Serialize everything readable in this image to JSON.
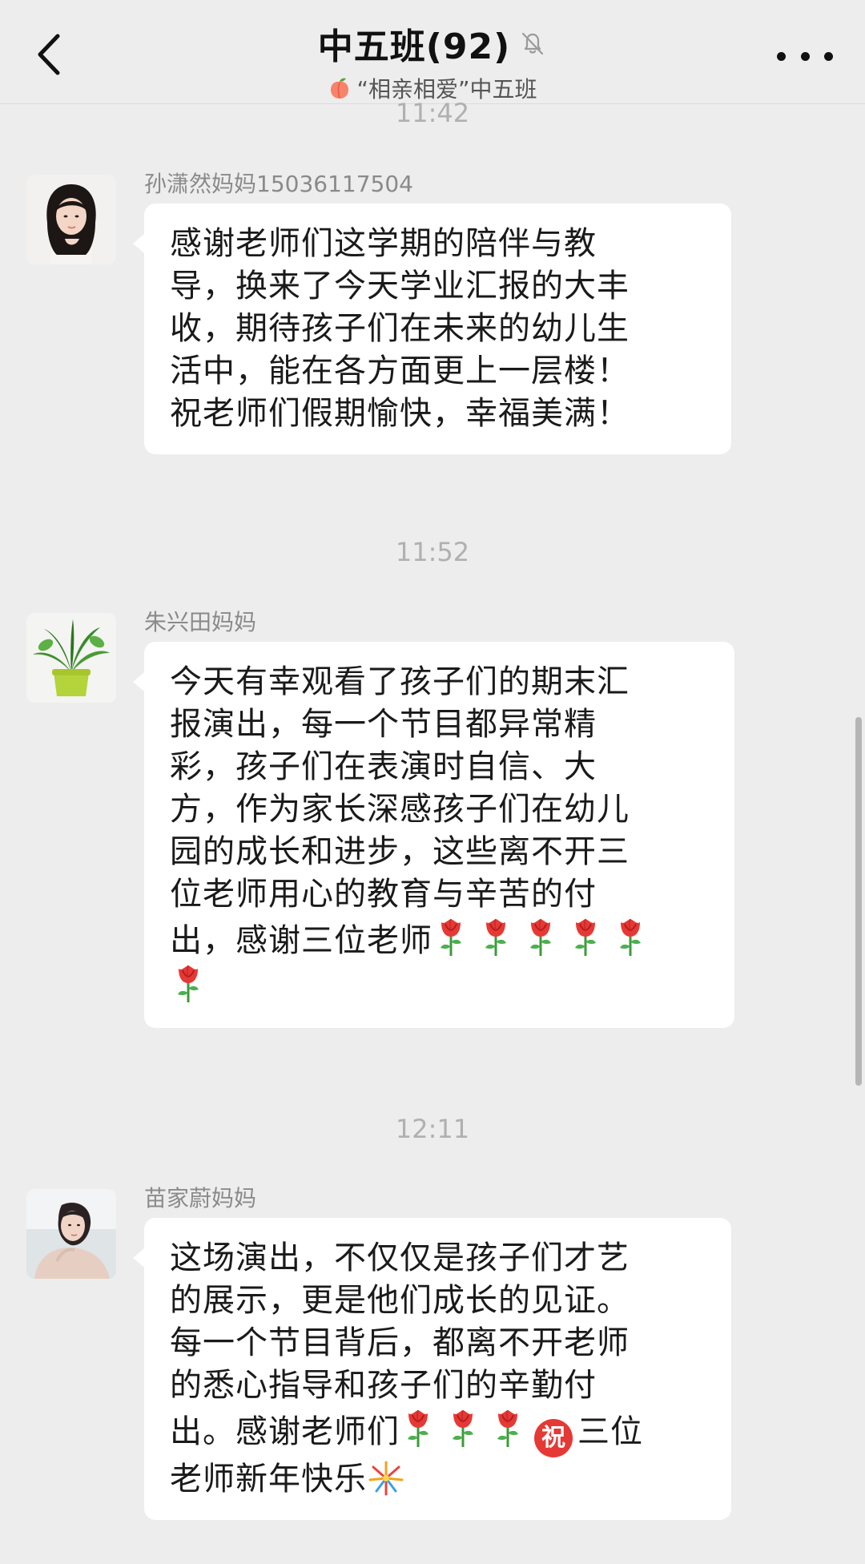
{
  "header": {
    "title": "中五班(92)",
    "subtitle": "“相亲相爱”中五班",
    "icons": {
      "back": "back-chevron-icon",
      "mute": "mute-bell-icon",
      "group": "peach-icon",
      "more": "more-dots-icon"
    }
  },
  "colors": {
    "background": "#ededed",
    "bubble": "#ffffff",
    "timestamp": "#b0b0b0",
    "sender": "#8a8a8a"
  },
  "chat": {
    "timestamps": [
      "11:42",
      "11:52",
      "12:11"
    ],
    "messages": [
      {
        "sender": "孙潇然妈妈15036117504",
        "avatar": "woman-portrait",
        "lines": [
          "感谢老师们这学期的陪伴与教",
          "导，换来了今天学业汇报的大丰",
          "收，期待孩子们在未来的幼儿生",
          "活中，能在各方面更上一层楼！",
          "祝老师们假期愉快，幸福美满！"
        ]
      },
      {
        "sender": "朱兴田妈妈",
        "avatar": "potted-plant",
        "lines": [
          "今天有幸观看了孩子们的期末汇",
          "报演出，每一个节目都异常精",
          "彩，孩子们在表演时自信、大",
          "方，作为家长深感孩子们在幼儿",
          "园的成长和进步，这些离不开三",
          "位老师用心的教育与辛苦的付",
          "出，感谢三位老师"
        ],
        "trailing_emoji": [
          "rose",
          "rose",
          "rose",
          "rose",
          "rose"
        ],
        "last_line_emoji": [
          "rose"
        ]
      },
      {
        "sender": "苗家蔚妈妈",
        "avatar": "woman-portrait-2",
        "lines": [
          "这场演出，不仅仅是孩子们才艺",
          "的展示，更是他们成长的见证。",
          "每一个节目背后，都离不开老师",
          "的悉心指导和孩子们的辛勤付",
          "出。感谢老师们"
        ],
        "line5_emoji": [
          "rose",
          "rose",
          "rose",
          "zhu"
        ],
        "zhu_text": "祝",
        "line5_tail": "三位",
        "line6": "老师新年快乐",
        "line6_emoji": [
          "fireworks"
        ]
      }
    ]
  }
}
